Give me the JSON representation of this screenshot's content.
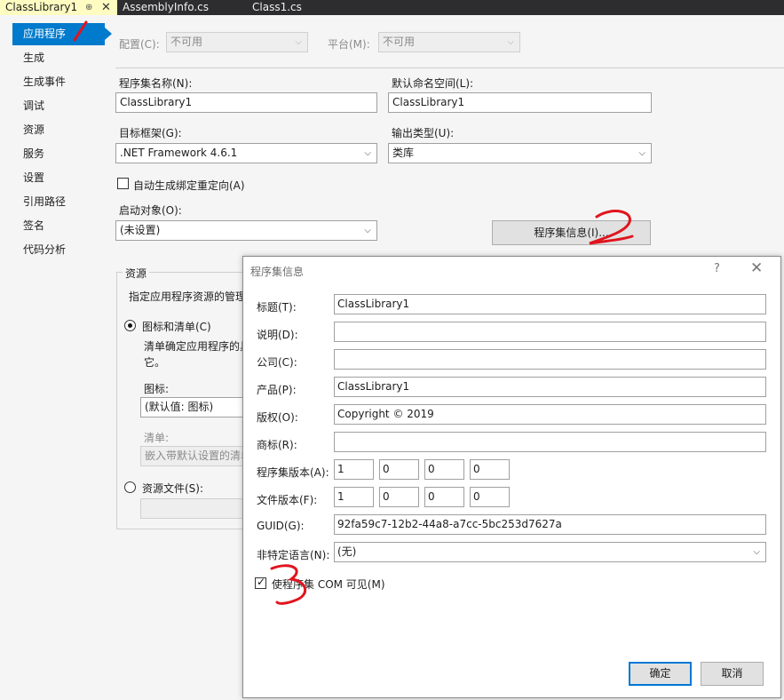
{
  "tabs": [
    {
      "label": "ClassLibrary1",
      "pin": "⊕",
      "close": "✕"
    },
    {
      "label": "AssemblyInfo.cs"
    },
    {
      "label": "Class1.cs"
    }
  ],
  "sidebar": {
    "items": [
      {
        "label": "应用程序"
      },
      {
        "label": "生成"
      },
      {
        "label": "生成事件"
      },
      {
        "label": "调试"
      },
      {
        "label": "资源"
      },
      {
        "label": "服务"
      },
      {
        "label": "设置"
      },
      {
        "label": "引用路径"
      },
      {
        "label": "签名"
      },
      {
        "label": "代码分析"
      }
    ]
  },
  "page": {
    "config_label": "配置(C):",
    "config_value": "不可用",
    "platform_label": "平台(M):",
    "platform_value": "不可用",
    "assembly_name_label": "程序集名称(N):",
    "assembly_name_value": "ClassLibrary1",
    "default_namespace_label": "默认命名空间(L):",
    "default_namespace_value": "ClassLibrary1",
    "target_framework_label": "目标框架(G):",
    "target_framework_value": ".NET Framework 4.6.1",
    "output_type_label": "输出类型(U):",
    "output_type_value": "类库",
    "auto_binding_label": "自动生成绑定重定向(A)",
    "startup_object_label": "启动对象(O):",
    "startup_object_value": "(未设置)",
    "assembly_info_button": "程序集信息(I)...",
    "resources_group_label": "资源",
    "resources_desc": "指定应用程序资源的管理",
    "icon_manifest_radio": "图标和清单(C)",
    "icon_manifest_desc_line1": "清单确定应用程序的具",
    "icon_manifest_desc_line2": "它。",
    "icon_label": "图标:",
    "icon_value": "(默认值: 图标)",
    "manifest_label": "清单:",
    "manifest_value": "嵌入带默认设置的清单",
    "resource_file_radio": "资源文件(S):"
  },
  "dialog": {
    "title": "程序集信息",
    "help": "?",
    "close": "✕",
    "fields": {
      "title_label": "标题(T):",
      "title_value": "ClassLibrary1",
      "description_label": "说明(D):",
      "description_value": "",
      "company_label": "公司(C):",
      "company_value": "",
      "product_label": "产品(P):",
      "product_value": "ClassLibrary1",
      "copyright_label": "版权(O):",
      "copyright_value": "Copyright ©  2019",
      "trademark_label": "商标(R):",
      "trademark_value": "",
      "assembly_version_label": "程序集版本(A):",
      "assembly_version": [
        "1",
        "0",
        "0",
        "0"
      ],
      "file_version_label": "文件版本(F):",
      "file_version": [
        "1",
        "0",
        "0",
        "0"
      ],
      "guid_label": "GUID(G):",
      "guid_value": "92fa59c7-12b2-44a8-a7cc-5bc253d7627a",
      "neutral_language_label": "非特定语言(N):",
      "neutral_language_value": "(无)",
      "com_visible_label": "使程序集 COM 可见(M)",
      "com_visible_checked": true
    },
    "ok_label": "确定",
    "cancel_label": "取消"
  },
  "colors": {
    "accent": "#007acc",
    "annotation": "#e0141e",
    "active_tab": "#fefcc1",
    "tab_strip": "#2d2d30"
  },
  "icons": [
    "pin-icon",
    "close-icon",
    "chevron-down-icon",
    "help-icon"
  ]
}
